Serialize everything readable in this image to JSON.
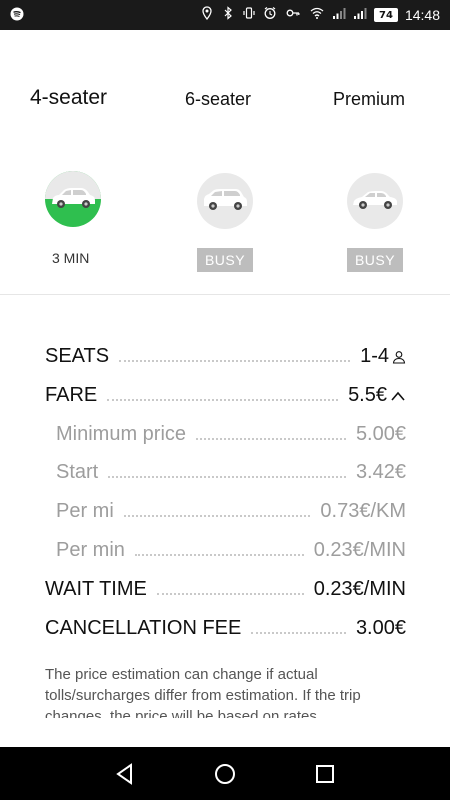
{
  "status_bar": {
    "time": "14:48",
    "battery": "74"
  },
  "tabs": [
    {
      "label": "4-seater"
    },
    {
      "label": "6-seater"
    },
    {
      "label": "Premium"
    }
  ],
  "cars": [
    {
      "eta": "3 MIN",
      "selected": true
    },
    {
      "badge": "BUSY",
      "selected": false
    },
    {
      "badge": "BUSY",
      "selected": false
    }
  ],
  "fare_table": {
    "seats": {
      "label": "SEATS",
      "value": "1-4"
    },
    "fare": {
      "label": "FARE",
      "value": "5.5€"
    },
    "minimum_price": {
      "label": "Minimum price",
      "value": "5.00€"
    },
    "start": {
      "label": "Start",
      "value": "3.42€"
    },
    "per_mi": {
      "label": "Per mi",
      "value": "0.73€/KM"
    },
    "per_min": {
      "label": "Per min",
      "value": "0.23€/MIN"
    },
    "wait_time": {
      "label": "WAIT TIME",
      "value": "0.23€/MIN"
    },
    "cancellation_fee": {
      "label": "CANCELLATION FEE",
      "value": "3.00€"
    }
  },
  "note": "The price estimation can change if actual tolls/surcharges differ from estimation. If the trip changes, the price will be based on rates",
  "colors": {
    "accent": "#2fbf4f",
    "busy_badge": "#bdbdbd",
    "muted_text": "#9d9d9d"
  }
}
